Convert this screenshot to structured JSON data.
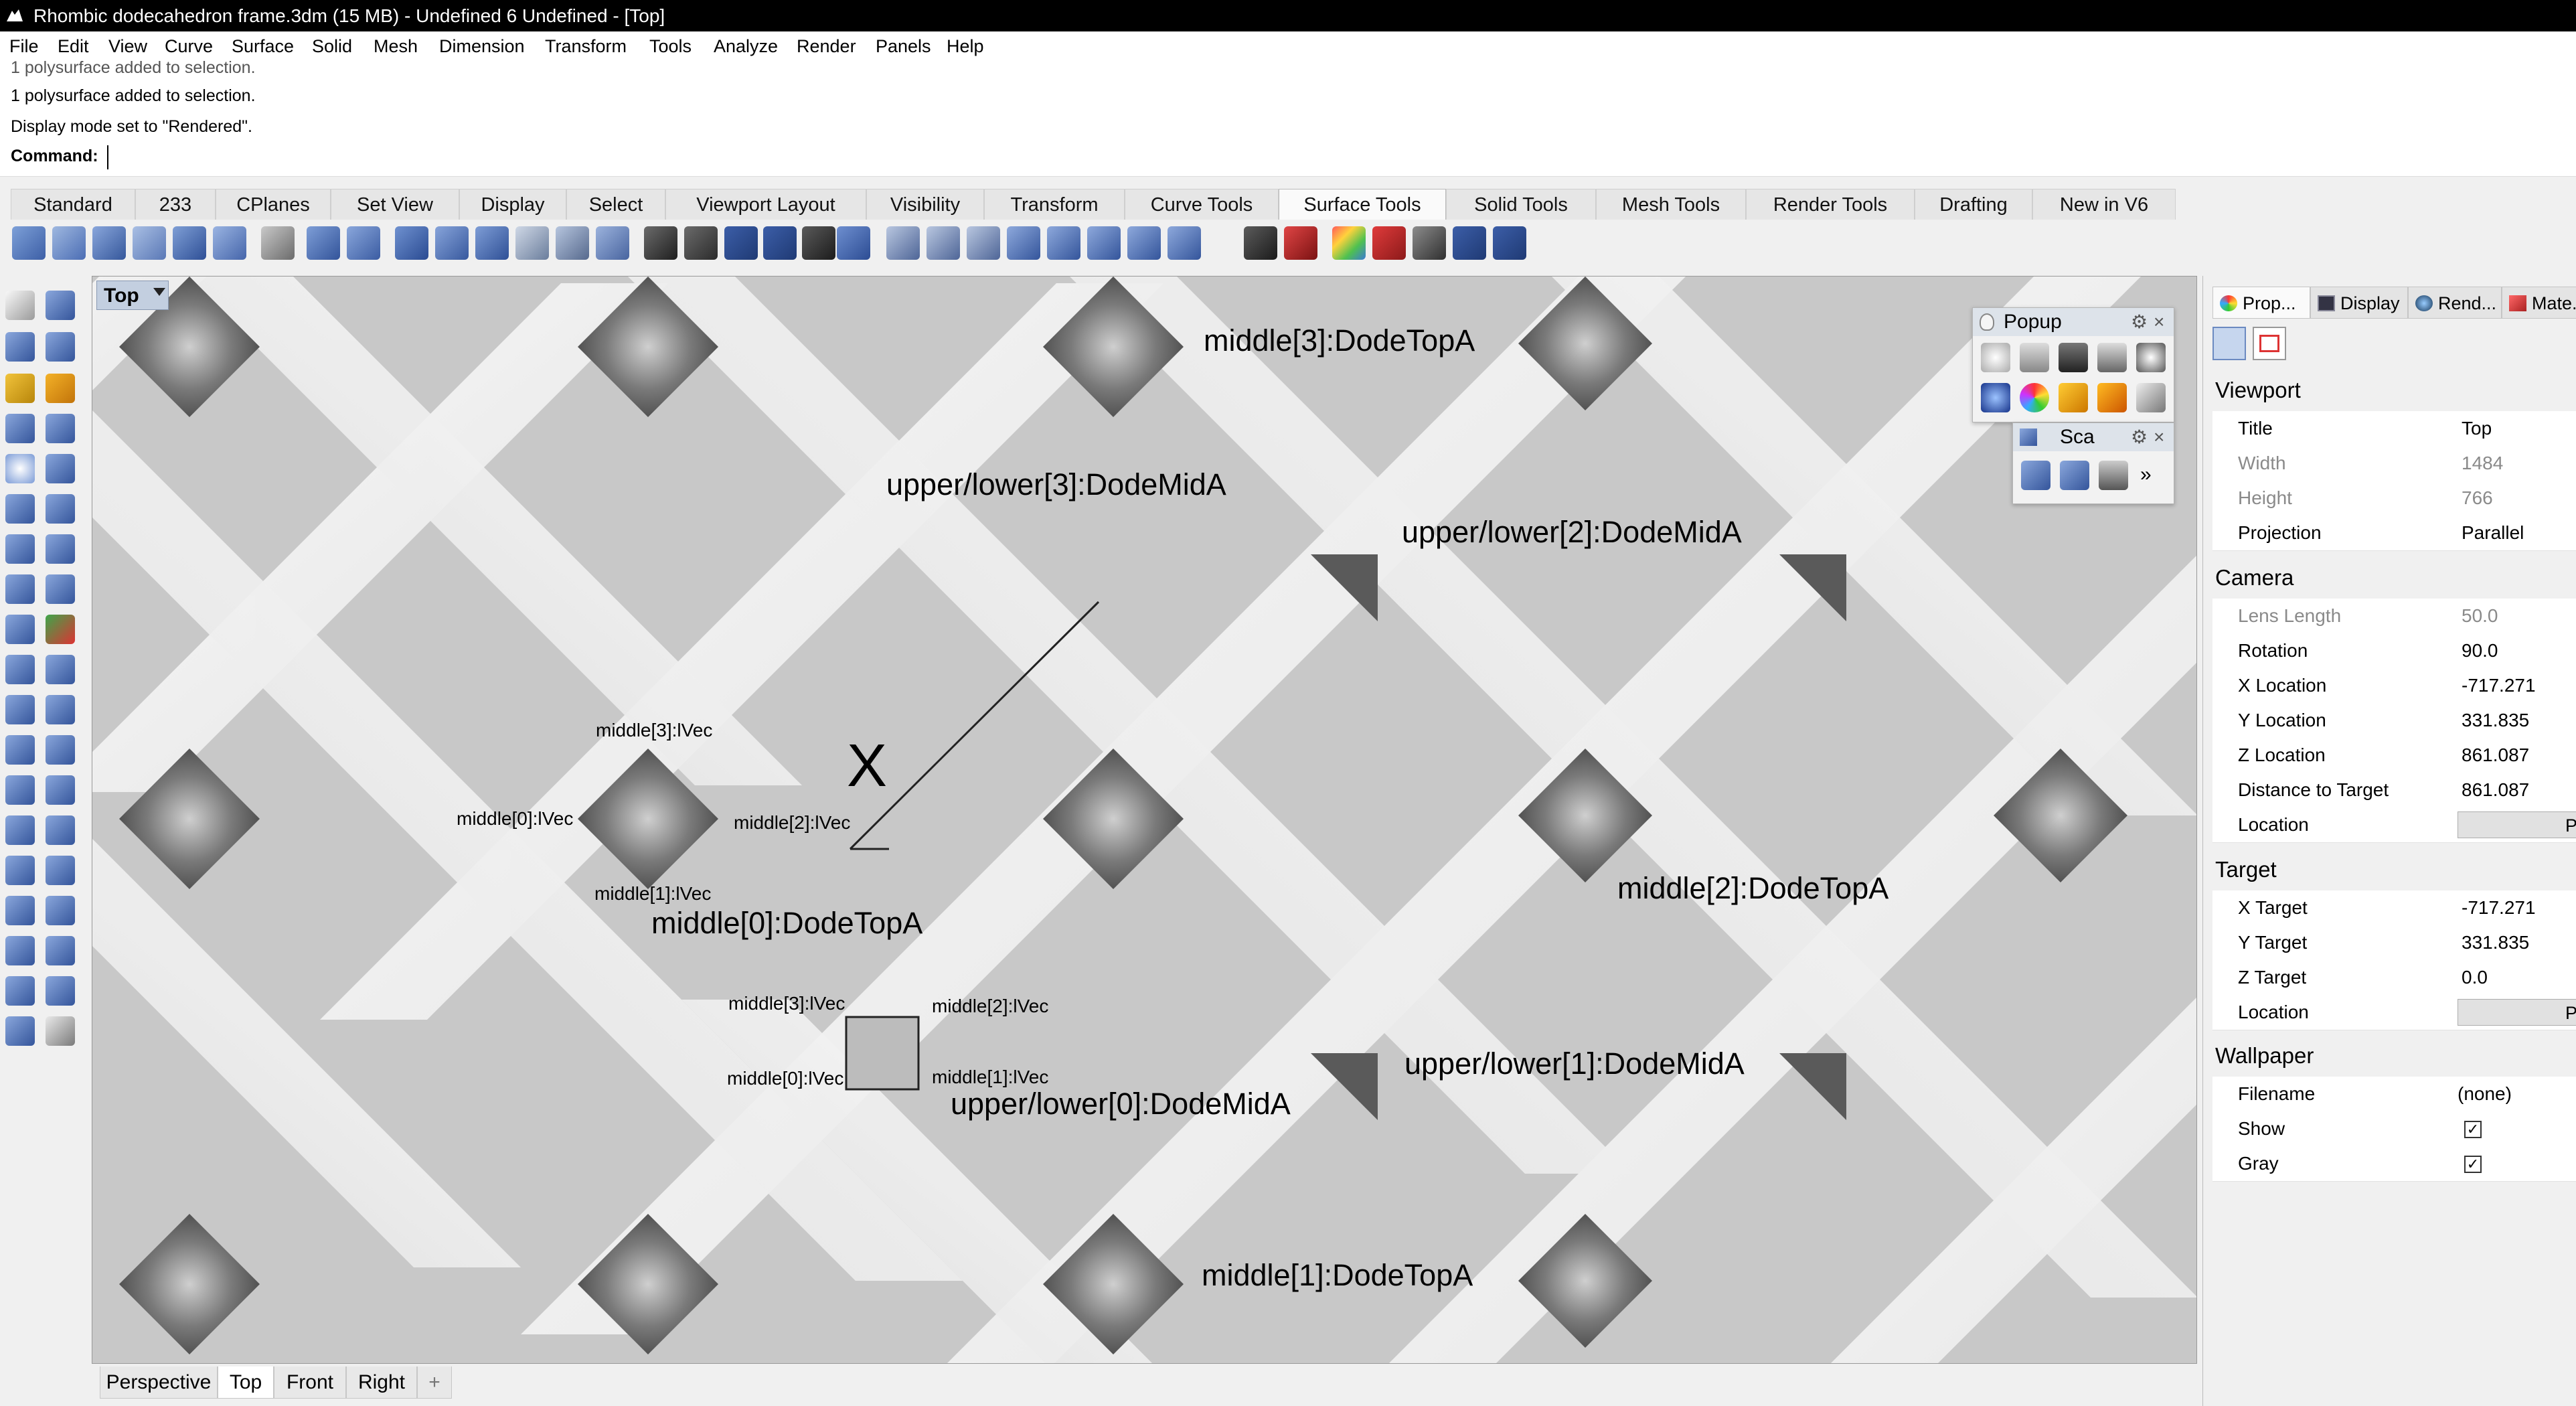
{
  "window": {
    "title": "Rhombic dodecahedron frame.3dm (15 MB) - Undefined 6 Undefined - [Top]"
  },
  "menu": [
    "File",
    "Edit",
    "View",
    "Curve",
    "Surface",
    "Solid",
    "Mesh",
    "Dimension",
    "Transform",
    "Tools",
    "Analyze",
    "Render",
    "Panels",
    "Help"
  ],
  "command_history": [
    "1 polysurface added to selection.",
    "1 polysurface added to selection.",
    "Display mode set to \"Rendered\"."
  ],
  "command": {
    "label": "Command:",
    "value": ""
  },
  "toolbar_tabs": [
    "Standard",
    "233",
    "CPlanes",
    "Set View",
    "Display",
    "Select",
    "Viewport Layout",
    "Visibility",
    "Transform",
    "Curve Tools",
    "Surface Tools",
    "Solid Tools",
    "Mesh Tools",
    "Render Tools",
    "Drafting",
    "New in V6"
  ],
  "active_toolbar_tab": "Surface Tools",
  "viewport": {
    "name": "Top",
    "axis_label": "X",
    "labels": [
      "middle[3]:DodeTopA",
      "upper/lower[3]:DodeMidA",
      "upper/lower[2]:DodeMidA",
      "middle[0]:DodeTopA",
      "middle[2]:DodeTopA",
      "upper/lower[1]:DodeMidA",
      "upper/lower[0]:DodeMidA",
      "middle[1]:DodeTopA"
    ],
    "small_labels_a": [
      "middle[3]:lVec",
      "middle[0]:lVec",
      "middle[2]:lVec",
      "middle[1]:lVec"
    ],
    "small_labels_b": [
      "middle[3]:lVec",
      "middle[2]:lVec",
      "middle[0]:lVec",
      "middle[1]:lVec"
    ]
  },
  "popup_panel": {
    "title": "Popup"
  },
  "scale_panel": {
    "title": "Sca"
  },
  "viewport_tabs": [
    "Perspective",
    "Top",
    "Front",
    "Right"
  ],
  "active_viewport_tab": "Top",
  "properties": {
    "tabs": [
      "Prop...",
      "Display",
      "Rend...",
      "Mate..."
    ],
    "sections": {
      "viewport": {
        "label": "Viewport",
        "rows": [
          {
            "key": "Title",
            "value": "Top"
          },
          {
            "key": "Width",
            "value": "1484"
          },
          {
            "key": "Height",
            "value": "766"
          },
          {
            "key": "Projection",
            "value": "Parallel"
          }
        ]
      },
      "camera": {
        "label": "Camera",
        "rows": [
          {
            "key": "Lens Length",
            "value": "50.0"
          },
          {
            "key": "Rotation",
            "value": "90.0"
          },
          {
            "key": "X Location",
            "value": "-717.271"
          },
          {
            "key": "Y Location",
            "value": "331.835"
          },
          {
            "key": "Z Location",
            "value": "861.087"
          },
          {
            "key": "Distance to Target",
            "value": "861.087"
          },
          {
            "key": "Location",
            "button": "Pl"
          }
        ]
      },
      "target": {
        "label": "Target",
        "rows": [
          {
            "key": "X Target",
            "value": "-717.271"
          },
          {
            "key": "Y Target",
            "value": "331.835"
          },
          {
            "key": "Z Target",
            "value": "0.0"
          },
          {
            "key": "Location",
            "button": "Pl"
          }
        ]
      },
      "wallpaper": {
        "label": "Wallpaper",
        "rows": [
          {
            "key": "Filename",
            "value": "(none)"
          },
          {
            "key": "Show",
            "checked": true
          },
          {
            "key": "Gray",
            "checked": true
          }
        ]
      }
    }
  },
  "colors": {
    "viewport_bg": "#c8c8c8",
    "title_bar": "#000000",
    "accent": "#3b7bd4"
  }
}
